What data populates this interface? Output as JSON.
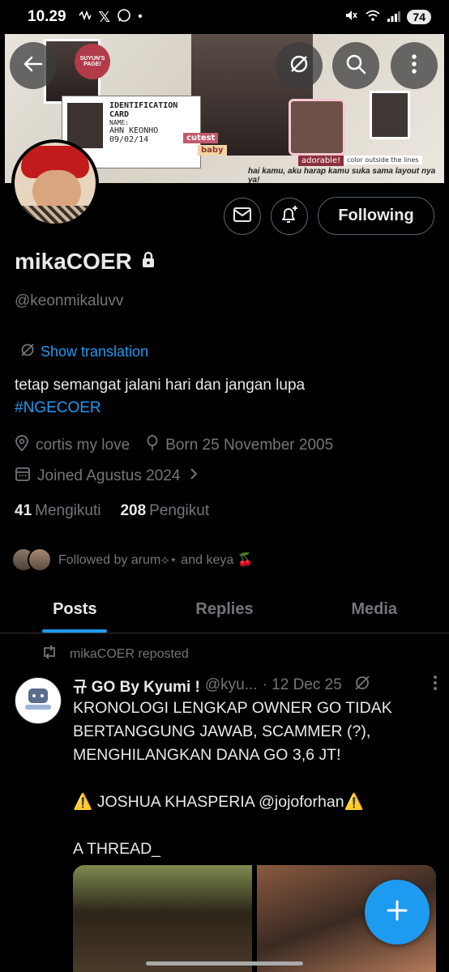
{
  "status_bar": {
    "time": "10.29",
    "icons_left": [
      "vibrate-icon",
      "x-logo-icon",
      "whatsapp-icon",
      "dot-icon"
    ],
    "icons_right": [
      "mute-icon",
      "wifi-icon",
      "signal-icon"
    ],
    "battery": "74"
  },
  "banner": {
    "id_card_title": "IDENTIFICATION CARD",
    "id_card_name_label": "NAME:",
    "id_card_name": "AHN KEONHO",
    "id_card_date": "09/02/14",
    "stamp_text": "SUYUN'S PAGE!",
    "tag_cutest": "cutest",
    "tag_baby": "baby",
    "tag_adorable": "adorable!",
    "tag_color": "color outside the lines",
    "caption": "hai kamu, aku harap kamu suka sama layout nya ya!"
  },
  "profile": {
    "display_name": "mikaCOER",
    "handle": "@keonmikaluvv",
    "show_translation": "Show translation",
    "bio_text": "tetap semangat jalani hari dan jangan lupa",
    "bio_hashtag": "#NGECOER",
    "location": "cortis my love",
    "born": "Born 25 November 2005",
    "joined": "Joined Agustus 2024",
    "following_count": "41",
    "following_label": "Mengikuti",
    "followers_count": "208",
    "followers_label": "Pengikut",
    "followed_by": "Followed by arum⟡⋆ and keya 🍒",
    "following_button": "Following"
  },
  "tabs": [
    {
      "label": "Posts",
      "active": true
    },
    {
      "label": "Replies",
      "active": false
    },
    {
      "label": "Media",
      "active": false
    }
  ],
  "post": {
    "repost_label": "mikaCOER reposted",
    "author_name": "규 GO By Kyumi !",
    "author_username": "@kyu...",
    "date": "· 12 Dec 25",
    "text": "KRONOLOGI LENGKAP OWNER GO TIDAK BERTANGGUNG JAWAB, SCAMMER (?), MENGHILANGKAN DANA GO 3,6 JT!\n\n⚠️ JOSHUA KHASPERIA @jojoforhan⚠️\n\nA THREAD_"
  },
  "colors": {
    "accent": "#1d9bf0",
    "background": "#000000",
    "text_primary": "#e7e9ea",
    "text_secondary": "#71767b"
  }
}
